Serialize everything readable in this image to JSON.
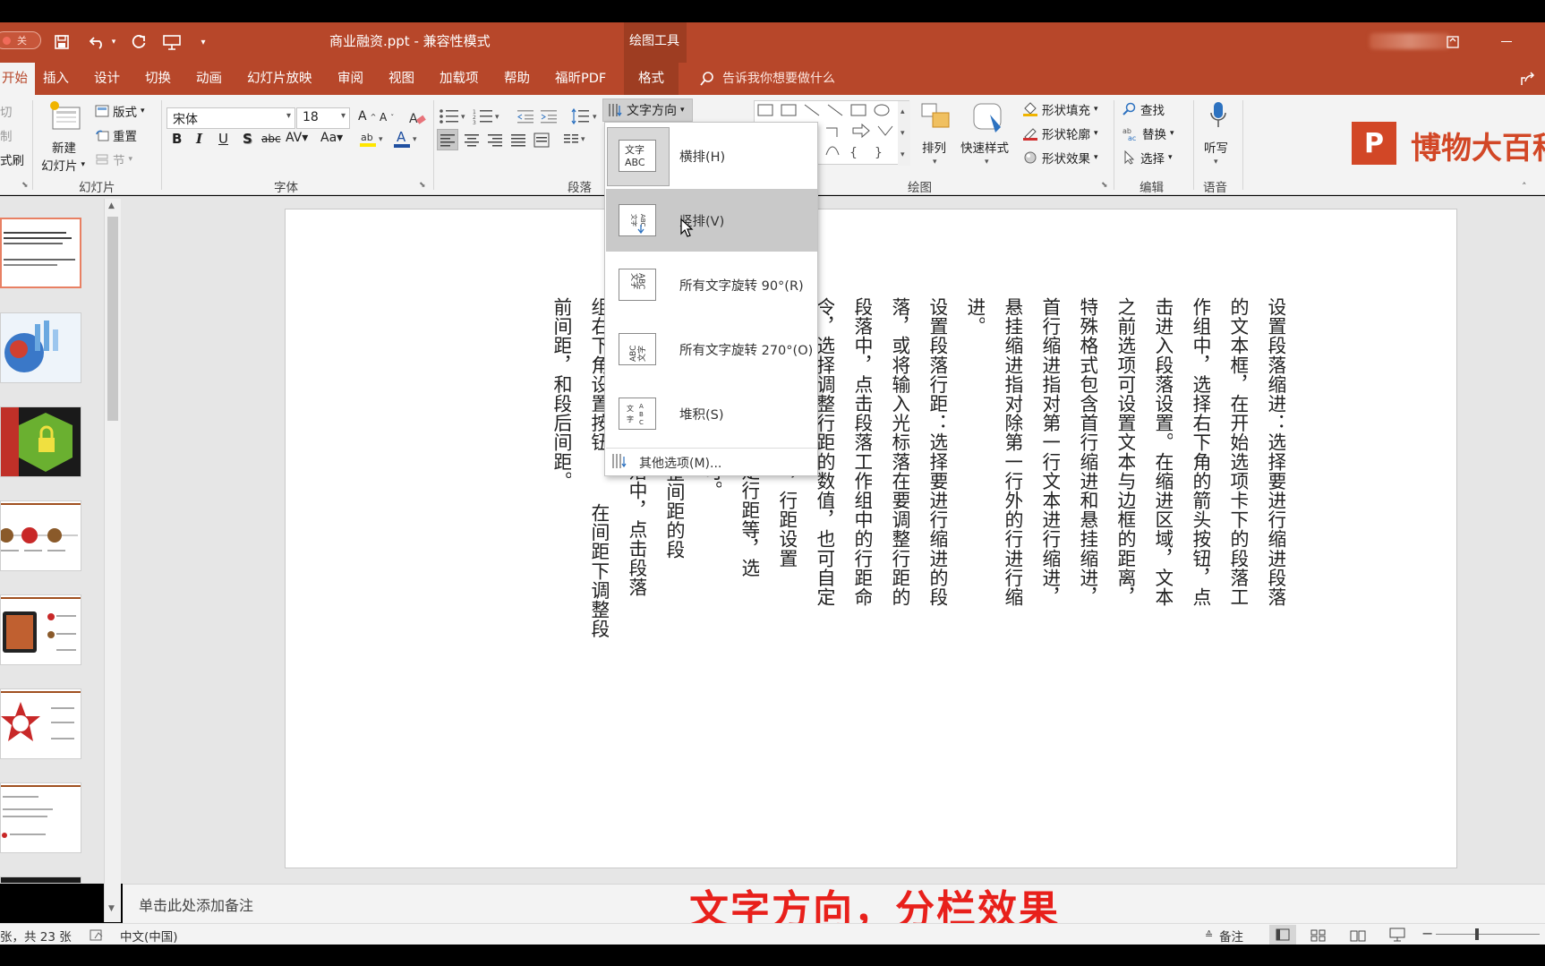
{
  "titlebar": {
    "toggle_label": "关",
    "doc_title": "商业融资.ppt  -  兼容性模式",
    "contextual_group": "绘图工具"
  },
  "tabs": [
    "开始",
    "插入",
    "设计",
    "切换",
    "动画",
    "幻灯片放映",
    "审阅",
    "视图",
    "加载项",
    "帮助",
    "福昕PDF",
    "格式"
  ],
  "tell_me": "告诉我你想要做什么",
  "ribbon": {
    "slides_group": {
      "label": "幻灯片",
      "new_slide_line1": "新建",
      "new_slide_line2": "幻灯片",
      "layout": "版式",
      "reset": "重置",
      "section": "节",
      "clipboard_cut": "切",
      "clipboard_copy": "制",
      "format_painter": "式刷"
    },
    "font_group": {
      "label": "字体",
      "font_name": "宋体",
      "font_size": "18"
    },
    "paragraph_group": {
      "label": "段落",
      "text_direction": "文字方向"
    },
    "drawing_group": {
      "label": "绘图",
      "arrange": "排列",
      "quick_styles": "快速样式",
      "shape_fill": "形状填充",
      "shape_outline": "形状轮廓",
      "shape_effects": "形状效果"
    },
    "editing_group": {
      "label": "编辑",
      "find": "查找",
      "replace": "替换",
      "select": "选择"
    },
    "voice_group": {
      "label": "语音",
      "dictate": "听写"
    }
  },
  "brand": {
    "logo_letter": "P",
    "text": "博物大百科"
  },
  "text_direction_menu": {
    "items": [
      {
        "label": "横排(H)",
        "icon": "horizontal-text-icon"
      },
      {
        "label": "竖排(V)",
        "icon": "vertical-text-icon"
      },
      {
        "label": "所有文字旋转 90°(R)",
        "icon": "rotate-90-icon"
      },
      {
        "label": "所有文字旋转 270°(O)",
        "icon": "rotate-270-icon"
      },
      {
        "label": "堆积(S)",
        "icon": "stacked-text-icon"
      }
    ],
    "more_options": "其他选项(M)...",
    "icon_texts": {
      "horizontal": "文字\nABC",
      "rotate90": "文字ABC",
      "stacked": "文字ABC"
    }
  },
  "slide": {
    "columns": [
      "设置段落缩进：选择要进行缩进段落",
      "的文本框，在开始选项卡下的段落工",
      "作组中，选择右下角的箭头按钮，点",
      "击进入段落设置。在缩进区域，文本",
      "之前选项可设置文本与边框的距离，",
      "特殊格式包含首行缩进和悬挂缩进，",
      "首行缩进指对第一行文本进行缩进，",
      "悬挂缩进指对除第一行外的行进行缩",
      "进。",
      "设置段落行距：选择要进行缩进的段",
      "落，或将输入光标落在要调整行距的",
      "段落中，点击段落工作组中的行距命",
      "令，选择调整行距的数值，也可自定",
      "义行距。点击选项卡，行距设置",
      "固定行距等，选",
      "即可。",
      "择要调整间距的段",
      "段落中，点击段落",
      "在间距下调整段",
      "组右下角设置按钮",
      "前间距，和段后间距。"
    ]
  },
  "notes_placeholder": "单击此处添加备注",
  "caption": "文字方向，分栏效果",
  "status": {
    "slide_count": "张，共 23 张",
    "language": "中文(中国)",
    "notes": "备注"
  }
}
